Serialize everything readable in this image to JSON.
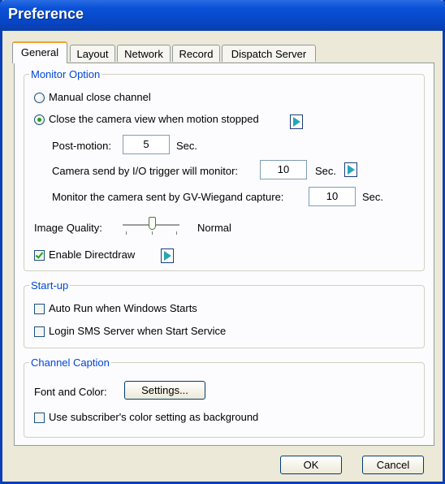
{
  "window": {
    "title": "Preference"
  },
  "tabs": [
    {
      "label": "General",
      "active": true
    },
    {
      "label": "Layout"
    },
    {
      "label": "Network"
    },
    {
      "label": "Record"
    },
    {
      "label": "Dispatch Server"
    }
  ],
  "monitor": {
    "legend": "Monitor Option",
    "manual_close_label": "Manual close channel",
    "close_camera_label": "Close the camera view when motion stopped",
    "post_motion_label": "Post-motion:",
    "post_motion_value": "5",
    "post_motion_unit": "Sec.",
    "io_trigger_label": "Camera send by I/O trigger will monitor:",
    "io_trigger_value": "10",
    "io_trigger_unit": "Sec.",
    "wiegand_label": "Monitor the camera sent by GV-Wiegand capture:",
    "wiegand_value": "10",
    "wiegand_unit": "Sec.",
    "image_quality_label": "Image Quality:",
    "image_quality_value": "Normal",
    "enable_directdraw_label": "Enable Directdraw"
  },
  "startup": {
    "legend": "Start-up",
    "auto_run_label": "Auto Run when Windows Starts",
    "login_sms_label": "Login SMS Server when Start Service"
  },
  "caption": {
    "legend": "Channel Caption",
    "font_color_label": "Font and Color:",
    "settings_button": "Settings...",
    "subscriber_color_label": "Use subscriber's color setting as background"
  },
  "buttons": {
    "ok": "OK",
    "cancel": "Cancel"
  },
  "colors": {
    "titlebar": "#0a52d8",
    "legend_text": "#0046d5",
    "tab_highlight": "#f0a22e",
    "check_mark": "#21a121",
    "play_icon": "#27a4b8"
  }
}
